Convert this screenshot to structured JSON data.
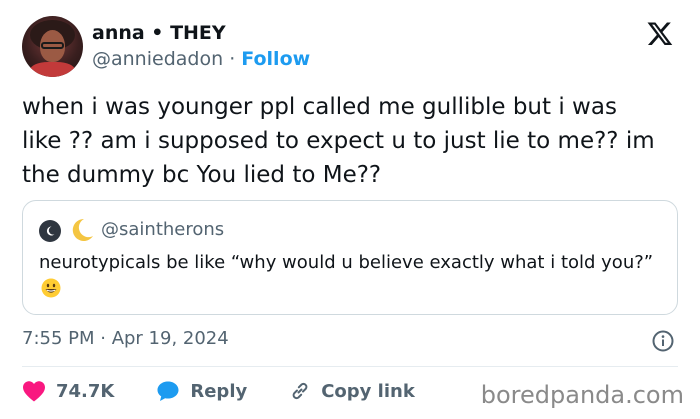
{
  "author": {
    "display_name": "anna • THEY",
    "handle": "@anniedadon",
    "separator": "·",
    "follow_label": "Follow"
  },
  "tweet": {
    "text": "when i was younger ppl called me gullible but i was like ?? am i supposed to expect u to just lie to me?? im the dummy bc You lied to Me??"
  },
  "quoted_tweet": {
    "handle": "@saintherons",
    "text": "neurotypicals be like “why would u believe exactly what i told you?”",
    "emoji": "grinning-face"
  },
  "meta": {
    "timestamp": "7:55 PM · Apr 19, 2024"
  },
  "actions": {
    "like_count": "74.7K",
    "reply_label": "Reply",
    "copy_link_label": "Copy link"
  },
  "watermark": "boredpanda.com",
  "colors": {
    "like_red": "#f91880",
    "link_blue": "#1d9bf0",
    "muted_gray": "#536471"
  },
  "icons": [
    "x-logo-icon",
    "heart-icon",
    "reply-bubble-icon",
    "link-icon",
    "info-icon",
    "moon-icon"
  ]
}
